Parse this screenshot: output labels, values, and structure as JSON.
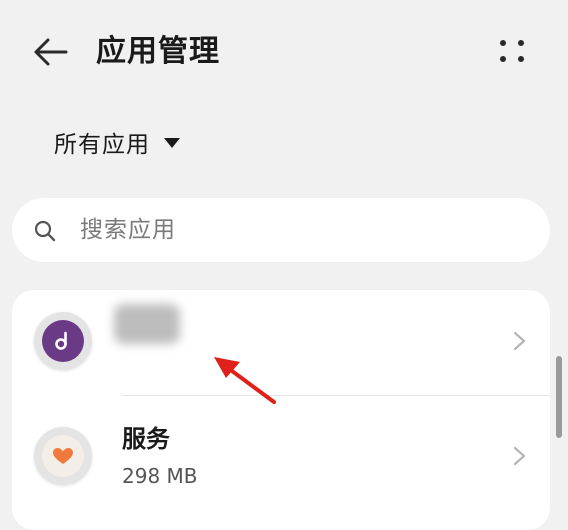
{
  "header": {
    "title": "应用管理",
    "back_icon": "arrow-left-icon",
    "more_icon": "more-dots-icon"
  },
  "filter": {
    "label": "所有应用",
    "caret_icon": "caret-down-icon"
  },
  "search": {
    "placeholder": "搜索应用",
    "icon": "search-icon"
  },
  "apps": [
    {
      "name": "",
      "size": "",
      "icon": "music-note-icon",
      "icon_color": "#6b3a87"
    },
    {
      "name": "服务",
      "size": "298 MB",
      "icon": "heart-icon",
      "icon_color": "#f07a3c"
    }
  ],
  "annotation": {
    "arrow_color": "#e0201a"
  }
}
